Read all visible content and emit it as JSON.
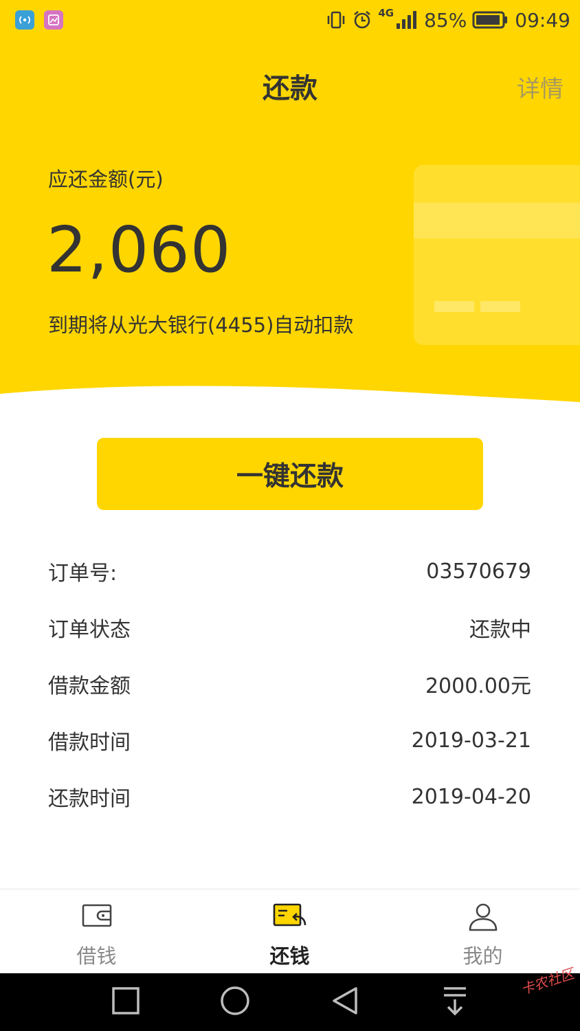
{
  "status_bar": {
    "battery": "85%",
    "time": "09:49",
    "network": "4G"
  },
  "header": {
    "title": "还款",
    "detail_link": "详情"
  },
  "summary": {
    "amount_label": "应还金额(元)",
    "amount": "2,060",
    "auto_debit_note": "到期将从光大银行(4455)自动扣款"
  },
  "actions": {
    "repay_button": "一键还款"
  },
  "order": {
    "rows": [
      {
        "label": "订单号:",
        "value": "03570679"
      },
      {
        "label": "订单状态",
        "value": "还款中"
      },
      {
        "label": "借款金额",
        "value": "2000.00元"
      },
      {
        "label": "借款时间",
        "value": "2019-03-21"
      },
      {
        "label": "还款时间",
        "value": "2019-04-20"
      }
    ]
  },
  "tabbar": {
    "tabs": [
      {
        "label": "借钱",
        "icon": "wallet-icon",
        "active": false
      },
      {
        "label": "还钱",
        "icon": "repay-card-icon",
        "active": true
      },
      {
        "label": "我的",
        "icon": "profile-icon",
        "active": false
      }
    ]
  },
  "watermark": "卡农社区",
  "colors": {
    "accent": "#FFD600",
    "text": "#333333",
    "muted": "#8a8a8a"
  }
}
